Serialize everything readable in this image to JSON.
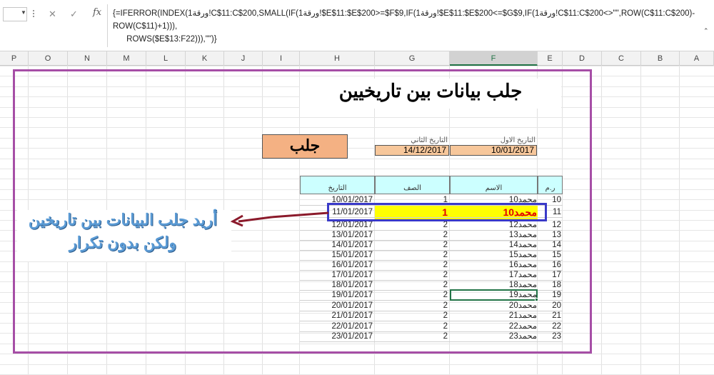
{
  "formula_bar": {
    "name_box": "",
    "cancel_icon": "✕",
    "enter_icon": "✓",
    "fx_label": "fx",
    "formula": "{=IFERROR(INDEX(ورقة1!C$11:C$200,SMALL(IF(ورقة1!$E$11:$E$200>=$F$9,IF(ورقة1!$E$11:$E$200<=$G$9,IF(ورقة1!C$11:C$200<>\"\",ROW(C$11:C$200)-ROW(C$11)+1))),\n      ROWS($E$13:F22))),\"\")}"
  },
  "columns": [
    "P",
    "O",
    "N",
    "M",
    "L",
    "K",
    "J",
    "I",
    "H",
    "G",
    "F",
    "E",
    "D",
    "C",
    "B",
    "A"
  ],
  "selected_column": "F",
  "sheet": {
    "title": "جلب بيانات بين تاريخيين",
    "first_date_label": "التاريخ الاول",
    "second_date_label": "التاريخ الثاني",
    "first_date": "10/01/2017",
    "second_date": "14/12/2017",
    "fetch_button": "جلب",
    "headers": {
      "num": "ر.م",
      "name": "الاسم",
      "class": "الصف",
      "date": "التاريخ"
    },
    "rows": [
      {
        "num": "10",
        "name": "محمد10",
        "class": "1",
        "date": "10/01/2017"
      },
      {
        "num": "11",
        "name": "محمد10",
        "class": "1",
        "date": "11/01/2017"
      },
      {
        "num": "12",
        "name": "محمد12",
        "class": "2",
        "date": "12/01/2017"
      },
      {
        "num": "13",
        "name": "محمد13",
        "class": "2",
        "date": "13/01/2017"
      },
      {
        "num": "14",
        "name": "محمد14",
        "class": "2",
        "date": "14/01/2017"
      },
      {
        "num": "15",
        "name": "محمد15",
        "class": "2",
        "date": "15/01/2017"
      },
      {
        "num": "16",
        "name": "محمد16",
        "class": "2",
        "date": "16/01/2017"
      },
      {
        "num": "17",
        "name": "محمد17",
        "class": "2",
        "date": "17/01/2017"
      },
      {
        "num": "18",
        "name": "محمد18",
        "class": "2",
        "date": "18/01/2017"
      },
      {
        "num": "19",
        "name": "محمد19",
        "class": "2",
        "date": "19/01/2017"
      },
      {
        "num": "20",
        "name": "محمد20",
        "class": "2",
        "date": "20/01/2017"
      },
      {
        "num": "21",
        "name": "محمد21",
        "class": "2",
        "date": "21/01/2017"
      },
      {
        "num": "22",
        "name": "محمد22",
        "class": "2",
        "date": "22/01/2017"
      },
      {
        "num": "23",
        "name": "محمد23",
        "class": "2",
        "date": "23/01/2017"
      }
    ],
    "highlight_row_index": 1,
    "note_line1": "أريد جلب البيانات بين تاريخين",
    "note_line2": "ولكن بدون تكرار"
  },
  "colors": {
    "frame": "#a64ea6",
    "highlight_box": "#3a3ac8",
    "highlight_fill": "#ffff00",
    "highlight_text": "#e00000",
    "header_fill": "#ccffff",
    "input_fill": "#f7c79b",
    "button_fill": "#f4b183",
    "arrow": "#8b1a2b",
    "selection": "#217346"
  }
}
